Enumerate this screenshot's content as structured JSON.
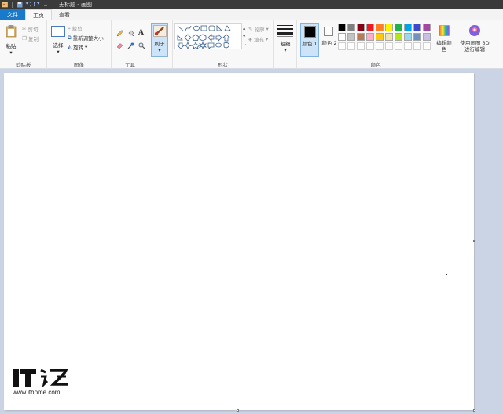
{
  "title_bar": {
    "title": "无标题 - 画图"
  },
  "tabs": [
    {
      "label": "文件"
    },
    {
      "label": "主页"
    },
    {
      "label": "查看"
    }
  ],
  "clipboard": {
    "paste": "粘贴",
    "cut": "剪切",
    "copy": "复制",
    "label": "剪贴板"
  },
  "image": {
    "select": "选择",
    "crop": "裁剪",
    "resize": "重新调整大小",
    "rotate": "旋转",
    "label": "图像"
  },
  "tools": {
    "label": "工具",
    "text_glyph": "A"
  },
  "brushes": {
    "label": "刷子"
  },
  "shapes": {
    "outline": "轮廓",
    "fill": "填充",
    "label": "形状"
  },
  "size": {
    "label": "粗细"
  },
  "colors": {
    "color1_label": "颜色 1",
    "color2_label": "颜色 2",
    "edit_label": "编辑颜色",
    "label": "颜色",
    "color1": "#000000",
    "color2": "#ffffff",
    "palette": [
      "#000000",
      "#7f7f7f",
      "#880015",
      "#ed1c24",
      "#ff7f27",
      "#fff200",
      "#22b14c",
      "#00a2e8",
      "#3f48cc",
      "#a349a4",
      "#ffffff",
      "#c3c3c3",
      "#b97a57",
      "#ffaec9",
      "#ffc90e",
      "#efe4b0",
      "#b5e61d",
      "#99d9ea",
      "#7092be",
      "#c8bfe7",
      "#ffffff",
      "#ffffff",
      "#ffffff",
      "#ffffff",
      "#ffffff",
      "#ffffff",
      "#ffffff",
      "#ffffff",
      "#ffffff",
      "#ffffff"
    ]
  },
  "paint3d": {
    "label": "使用画图 3D 进行编辑"
  },
  "watermark": {
    "logo_text": "IT之家",
    "url": "www.ithome.com"
  }
}
